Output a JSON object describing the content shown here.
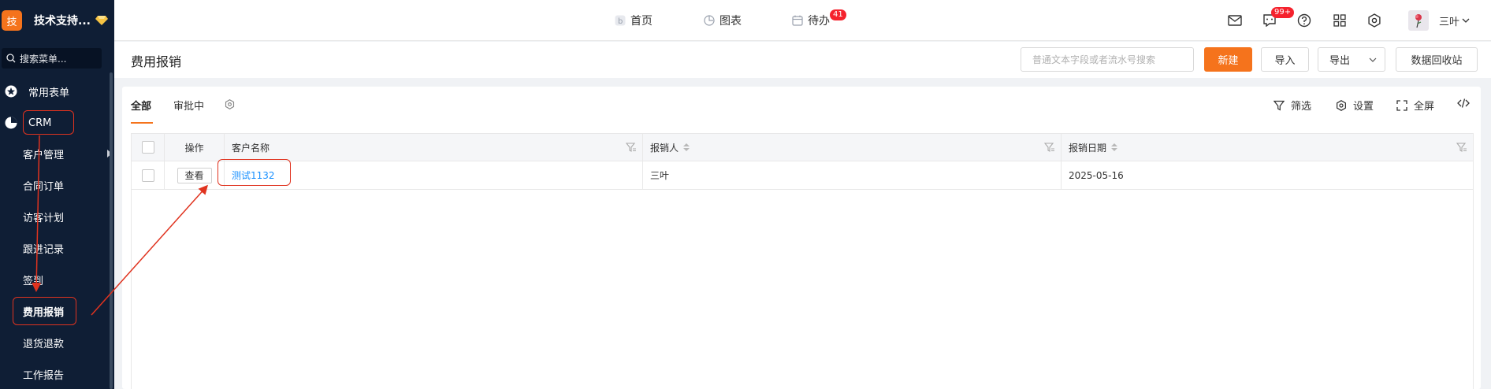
{
  "sidebar": {
    "brand_logo": "技",
    "brand_name": "技术支持...",
    "search_placeholder": "搜索菜单...",
    "items": [
      {
        "label": "常用表单",
        "icon": "star-icon"
      },
      {
        "label": "CRM",
        "icon": "pie-chart-icon"
      }
    ],
    "sub_items": [
      "客户管理",
      "合同订单",
      "访客计划",
      "跟进记录",
      "签到",
      "费用报销",
      "退货退款",
      "工作报告"
    ]
  },
  "topbar": {
    "tabs": [
      {
        "label": "首页",
        "icon": "home-icon"
      },
      {
        "label": "图表",
        "icon": "chart-icon"
      },
      {
        "label": "待办",
        "icon": "calendar-icon",
        "badge": "41"
      }
    ],
    "message_badge": "99+",
    "user_name": "三叶"
  },
  "page": {
    "title": "费用报销",
    "search_placeholder": "普通文本字段或者流水号搜索",
    "new_label": "新建",
    "import_label": "导入",
    "export_label": "导出",
    "recycle_label": "数据回收站"
  },
  "panel": {
    "tabs": [
      "全部",
      "审批中"
    ],
    "tools": [
      "筛选",
      "设置",
      "全屏"
    ]
  },
  "table": {
    "columns": [
      "操作",
      "客户名称",
      "报销人",
      "报销日期"
    ],
    "rows": [
      {
        "action": "查看",
        "customer": "测试1132",
        "person": "三叶",
        "date": "2025-05-16"
      }
    ]
  },
  "colors": {
    "accent": "#f5731c",
    "sidebar_bg": "#0f1e35",
    "link": "#1890ff",
    "annotation": "#e0331f"
  }
}
